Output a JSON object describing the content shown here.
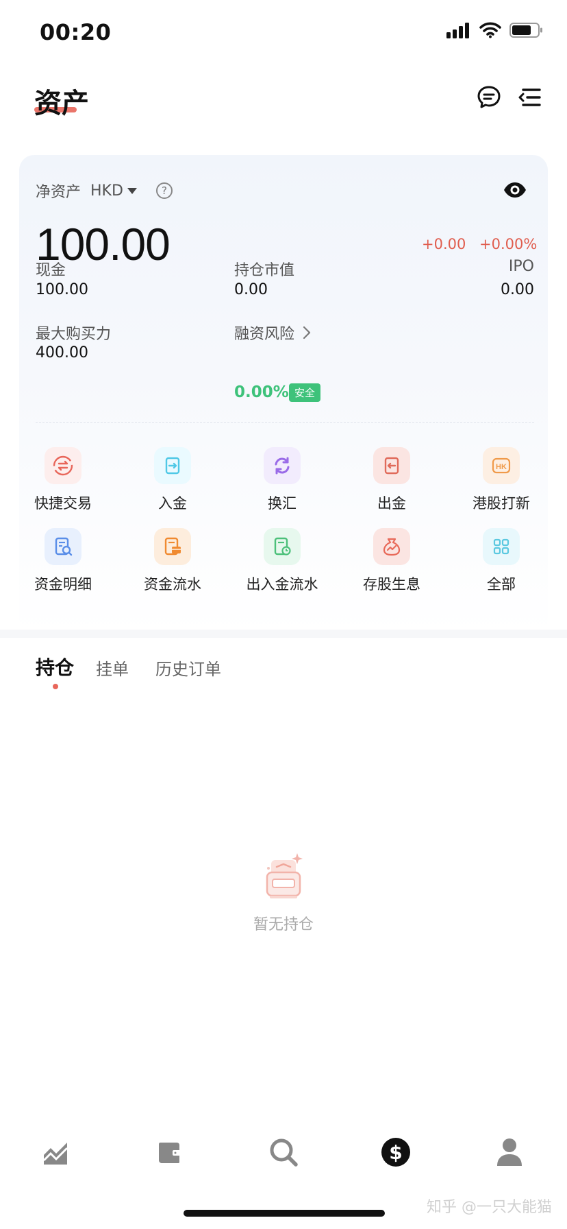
{
  "status": {
    "time": "00:20"
  },
  "header": {
    "title": "资产"
  },
  "card": {
    "net_asset_label": "净资产",
    "currency": "HKD",
    "help_symbol": "?",
    "total": "100.00",
    "change_amount": "+0.00",
    "change_percent": "+0.00%",
    "metrics": {
      "cash_label": "现金",
      "cash_value": "100.00",
      "position_label": "持仓市值",
      "position_value": "0.00",
      "ipo_label": "IPO",
      "ipo_value": "0.00",
      "buying_power_label": "最大购买力",
      "buying_power_value": "400.00",
      "risk_label": "融资风险",
      "risk_value": "0.00%",
      "risk_badge": "安全"
    }
  },
  "actions": [
    {
      "label": "快捷交易",
      "icon": "quick-trade-icon",
      "color": "#e8665a"
    },
    {
      "label": "入金",
      "icon": "deposit-icon",
      "color": "#4fc8e6"
    },
    {
      "label": "换汇",
      "icon": "exchange-icon",
      "color": "#9a6be8"
    },
    {
      "label": "出金",
      "icon": "withdraw-icon",
      "color": "#e06a5a"
    },
    {
      "label": "港股打新",
      "icon": "hk-ipo-icon",
      "color": "#f09a4a"
    },
    {
      "label": "资金明细",
      "icon": "fund-detail-icon",
      "color": "#5a8ee8"
    },
    {
      "label": "资金流水",
      "icon": "fund-flow-icon",
      "color": "#f08a30"
    },
    {
      "label": "出入金流水",
      "icon": "transfer-record-icon",
      "color": "#4cc07a"
    },
    {
      "label": "存股生息",
      "icon": "stock-interest-icon",
      "color": "#e86a5a"
    },
    {
      "label": "全部",
      "icon": "all-apps-icon",
      "color": "#5ac8e0"
    }
  ],
  "tabs": [
    {
      "label": "持仓"
    },
    {
      "label": "挂单"
    },
    {
      "label": "历史订单"
    }
  ],
  "empty": {
    "text": "暂无持仓"
  },
  "watermark": "知乎 @一只大能猫",
  "colors": {
    "accent": "#e8665a",
    "up": "#e05d4e",
    "safe": "#3ec27a"
  }
}
